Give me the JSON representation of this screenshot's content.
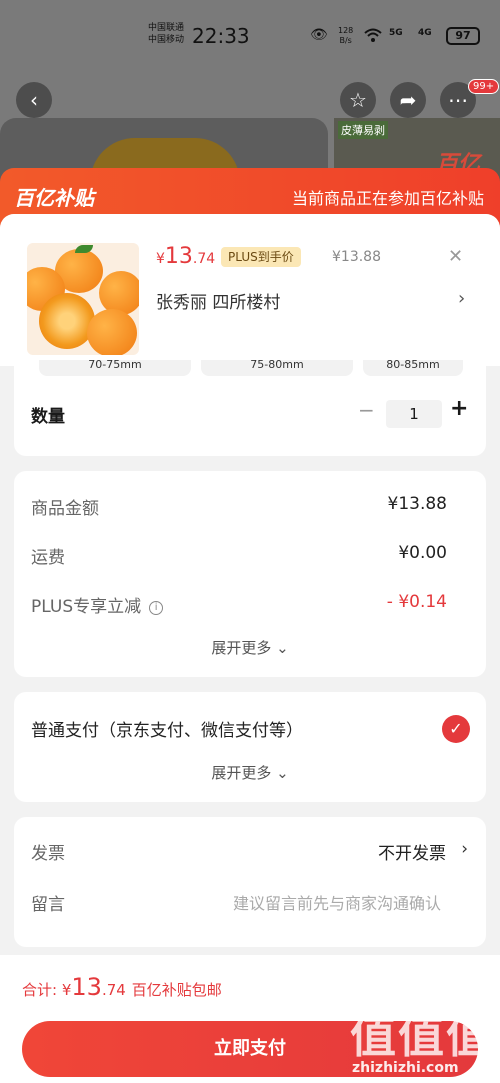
{
  "status_bar": {
    "carrier1": "中国联通",
    "carrier2": "中国移动",
    "time": "22:33",
    "net_speed_value": "128",
    "net_speed_unit": "B/s",
    "sig1": "5G",
    "sig2": "4G",
    "battery": "97"
  },
  "header": {
    "back_icon": "back-arrow-icon",
    "favorite_icon": "star-icon",
    "share_icon": "share-icon",
    "more_icon": "more-dots-icon",
    "more_badge": "99+",
    "thumb_tag": "皮薄易剥",
    "thumb_logo": "百亿"
  },
  "subsidy_banner": {
    "logo": "百亿补贴",
    "text": "当前商品正在参加百亿补贴"
  },
  "product": {
    "price_currency": "¥",
    "price_int": "13",
    "price_dec": ".74",
    "plus_tag": "PLUS到手价",
    "original_price": "¥13.88",
    "address": "张秀丽  四所楼村"
  },
  "spec_chips": [
    "70-75mm",
    "75-80mm",
    "80-85mm"
  ],
  "quantity": {
    "label": "数量",
    "value": "1",
    "minus": "−",
    "plus": "+"
  },
  "summary": {
    "rows": [
      {
        "label": "商品金额",
        "value": "¥13.88"
      },
      {
        "label": "运费",
        "value": "¥0.00"
      },
      {
        "label": "PLUS专享立减",
        "value": "- ¥0.14"
      }
    ],
    "expand": "展开更多 ⌄"
  },
  "payment": {
    "method": "普通支付（京东支付、微信支付等）",
    "expand": "展开更多 ⌄"
  },
  "extra": {
    "invoice_label": "发票",
    "invoice_value": "不开发票",
    "message_label": "留言",
    "message_placeholder": "建议留言前先与商家沟通确认"
  },
  "bottom": {
    "total_label": "合计:",
    "total_currency": "¥",
    "total_int": "13",
    "total_dec": ".74",
    "total_note": "百亿补贴包邮",
    "pay_button": "立即支付"
  },
  "watermark": {
    "text": "值值值",
    "url": "zhizhizhi.com"
  },
  "colors": {
    "accent": "#e4393c",
    "banner": "#f25a2a",
    "plus_tag_bg": "#fbe7b5"
  }
}
